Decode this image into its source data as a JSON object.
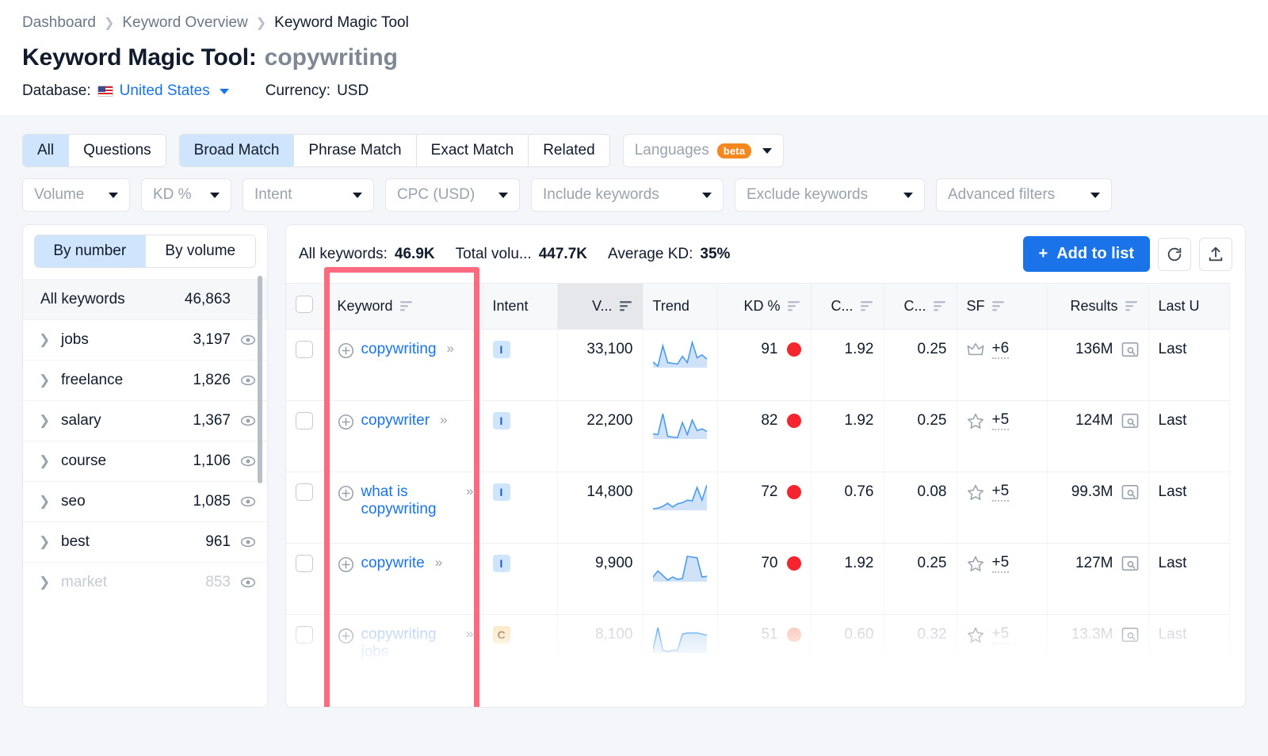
{
  "breadcrumb": [
    {
      "label": "Dashboard"
    },
    {
      "label": "Keyword Overview"
    },
    {
      "label": "Keyword Magic Tool"
    }
  ],
  "header": {
    "title": "Keyword Magic Tool:",
    "term": "copywriting",
    "database_label": "Database:",
    "database_value": "United States",
    "currency_label": "Currency:",
    "currency_value": "USD"
  },
  "filters": {
    "type_tabs": [
      {
        "label": "All",
        "active": true
      },
      {
        "label": "Questions",
        "active": false
      }
    ],
    "match_tabs": [
      {
        "label": "Broad Match",
        "active": true
      },
      {
        "label": "Phrase Match",
        "active": false
      },
      {
        "label": "Exact Match",
        "active": false
      },
      {
        "label": "Related",
        "active": false
      }
    ],
    "languages": {
      "label": "Languages",
      "badge": "beta"
    },
    "dropdowns": [
      {
        "label": "Volume"
      },
      {
        "label": "KD %"
      },
      {
        "label": "Intent"
      },
      {
        "label": "CPC (USD)"
      },
      {
        "label": "Include keywords"
      },
      {
        "label": "Exclude keywords"
      },
      {
        "label": "Advanced filters"
      }
    ]
  },
  "sidebar": {
    "toggle": [
      {
        "label": "By number",
        "active": true
      },
      {
        "label": "By volume",
        "active": false
      }
    ],
    "all_keywords": {
      "label": "All keywords",
      "count": "46,863"
    },
    "groups": [
      {
        "label": "jobs",
        "count": "3,197",
        "faded": false
      },
      {
        "label": "freelance",
        "count": "1,826",
        "faded": false
      },
      {
        "label": "salary",
        "count": "1,367",
        "faded": false
      },
      {
        "label": "course",
        "count": "1,106",
        "faded": false
      },
      {
        "label": "seo",
        "count": "1,085",
        "faded": false
      },
      {
        "label": "best",
        "count": "961",
        "faded": false
      },
      {
        "label": "market",
        "count": "853",
        "faded": true
      }
    ]
  },
  "toolbar": {
    "stats": [
      {
        "label": "All keywords:",
        "value": "46.9K"
      },
      {
        "label": "Total volu...",
        "value": "447.7K"
      },
      {
        "label": "Average KD:",
        "value": "35%"
      }
    ],
    "add_to_list": "Add to list",
    "add_plus": "+",
    "refresh_icon": "refresh-icon",
    "export_icon": "export-icon"
  },
  "table": {
    "columns": [
      {
        "label": "",
        "key": "checkbox",
        "sortable": false
      },
      {
        "label": "Keyword",
        "key": "keyword",
        "sortable": true
      },
      {
        "label": "Intent",
        "key": "intent",
        "sortable": false
      },
      {
        "label": "V...",
        "key": "volume",
        "sortable": true,
        "highlight": true
      },
      {
        "label": "Trend",
        "key": "trend",
        "sortable": false
      },
      {
        "label": "KD %",
        "key": "kd",
        "sortable": true
      },
      {
        "label": "C...",
        "key": "cpc",
        "sortable": true
      },
      {
        "label": "C...",
        "key": "com",
        "sortable": true
      },
      {
        "label": "SF",
        "key": "sf",
        "sortable": true
      },
      {
        "label": "Results",
        "key": "results",
        "sortable": true
      },
      {
        "label": "Last U",
        "key": "last_update",
        "sortable": false
      }
    ],
    "rows": [
      {
        "keyword": "copywriting",
        "intent": "I",
        "volume": "33,100",
        "trend": [
          32,
          20,
          78,
          30,
          28,
          26,
          48,
          30,
          88,
          44,
          52,
          40
        ],
        "kd": "91",
        "kd_color": "#f5252f",
        "cpc": "1.92",
        "com": "0.25",
        "sf_icon": "crown-icon",
        "sf_more": "+6",
        "results": "136M",
        "last_update": "Last",
        "faded": false
      },
      {
        "keyword": "copywriter",
        "intent": "I",
        "volume": "22,200",
        "trend": [
          36,
          34,
          86,
          30,
          28,
          27,
          64,
          34,
          70,
          44,
          48,
          42
        ],
        "kd": "82",
        "kd_color": "#f5252f",
        "cpc": "1.92",
        "com": "0.25",
        "sf_icon": "star-icon",
        "sf_more": "+5",
        "results": "124M",
        "last_update": "Last",
        "faded": false
      },
      {
        "keyword": "what is copywriting",
        "intent": "I",
        "volume": "14,800",
        "trend": [
          18,
          20,
          26,
          36,
          24,
          34,
          38,
          46,
          44,
          88,
          46,
          96
        ],
        "kd": "72",
        "kd_color": "#f5252f",
        "cpc": "0.76",
        "com": "0.08",
        "sf_icon": "star-icon",
        "sf_more": "+5",
        "results": "99.3M",
        "last_update": "Last",
        "faded": false
      },
      {
        "keyword": "copywrite",
        "intent": "I",
        "volume": "9,900",
        "trend": [
          34,
          50,
          38,
          26,
          34,
          28,
          30,
          88,
          86,
          84,
          34,
          36
        ],
        "kd": "70",
        "kd_color": "#f5252f",
        "cpc": "1.92",
        "com": "0.25",
        "sf_icon": "star-icon",
        "sf_more": "+5",
        "results": "127M",
        "last_update": "Last",
        "faded": false
      },
      {
        "keyword": "copywriting jobs",
        "intent": "C",
        "volume": "8,100",
        "trend": [
          30,
          70,
          28,
          26,
          28,
          28,
          58,
          60,
          60,
          60,
          58,
          56
        ],
        "kd": "51",
        "kd_color": "#fbc1b3",
        "cpc": "0.60",
        "com": "0.32",
        "sf_icon": "star-icon",
        "sf_more": "+5",
        "results": "13.3M",
        "last_update": "Last",
        "faded": true
      }
    ]
  },
  "colors": {
    "accent": "#1a73e8",
    "highlight_box": "#fb6a7e",
    "beta_badge": "#f5871f",
    "kd_high": "#f5252f",
    "intent_info_bg": "#cfe4fd",
    "intent_commercial_bg": "#fbe6c0"
  }
}
